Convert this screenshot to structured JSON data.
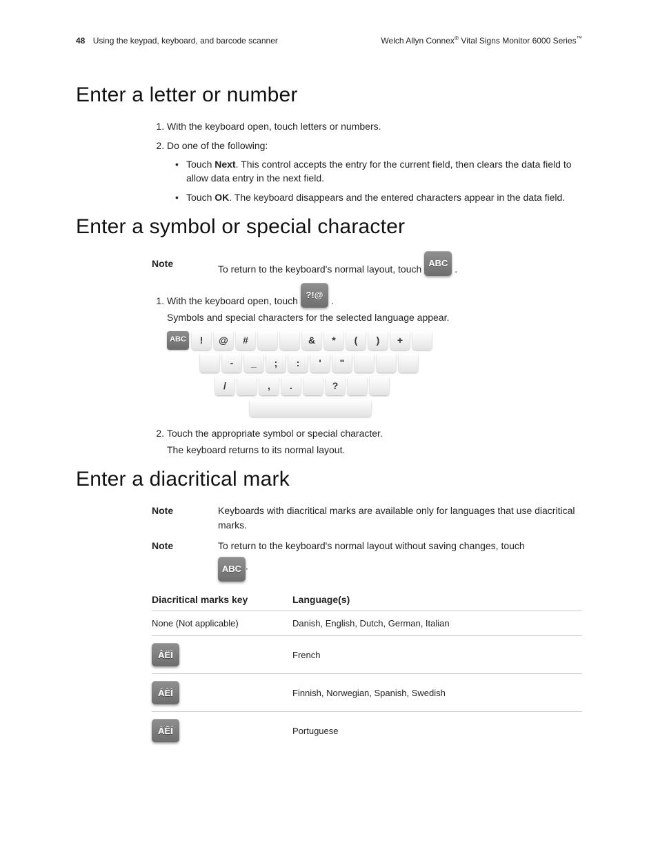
{
  "header": {
    "page_number": "48",
    "section": "Using the keypad, keyboard, and barcode scanner",
    "brand_pre": "Welch Allyn Connex",
    "reg1": "®",
    "brand_post": " Vital Signs Monitor 6000 Series",
    "tm": "™"
  },
  "sections": {
    "letter": {
      "heading": "Enter a letter or number",
      "step1": "With the keyboard open, touch letters or numbers.",
      "step2": "Do one of the following:",
      "bullet1_pre": "Touch ",
      "bullet1_bold": "Next",
      "bullet1_post": ". This control accepts the entry for the current field, then clears the data field to allow data entry in the next field.",
      "bullet2_pre": "Touch ",
      "bullet2_bold": "OK",
      "bullet2_post": ". The keyboard disappears and the entered characters appear in the data field."
    },
    "symbol": {
      "heading": "Enter a symbol or special character",
      "note_label": "Note",
      "note_text": "To return to the keyboard's normal layout, touch ",
      "abc_icon": "ABC",
      "step1_pre": "With the keyboard open, touch ",
      "step1_icon": "?!@",
      "step1_after": "Symbols and special characters for the selected language appear.",
      "kb": {
        "row1": [
          "!",
          "@",
          "#",
          "",
          "",
          "&",
          "*",
          "(",
          ")",
          "+",
          ""
        ],
        "row2": [
          "",
          "-",
          "_",
          ";",
          ":",
          "'",
          "\"",
          "",
          "",
          ""
        ],
        "row3": [
          "/",
          "",
          ",",
          ".",
          "",
          "?",
          "",
          ""
        ]
      },
      "step2": "Touch the appropriate symbol or special character.",
      "step2_after": "The keyboard returns to its normal layout."
    },
    "diacritical": {
      "heading": "Enter a diacritical mark",
      "note_label": "Note",
      "note1": "Keyboards with diacritical marks are available only for languages that use diacritical marks.",
      "note2_pre": "To return to the keyboard's normal layout without saving changes, touch",
      "abc_icon": "ABC",
      "table": {
        "col1_header": "Diacritical marks key",
        "col2_header": "Language(s)",
        "rows": [
          {
            "key": "None (Not applicable)",
            "is_text": true,
            "langs": "Danish, English, Dutch, German, Italian"
          },
          {
            "key": "ÂËÌ",
            "is_text": false,
            "langs": "French"
          },
          {
            "key": "ÁÈÌ",
            "is_text": false,
            "langs": "Finnish, Norwegian, Spanish, Swedish"
          },
          {
            "key": "ÀÊÍ",
            "is_text": false,
            "langs": "Portuguese"
          }
        ]
      }
    }
  }
}
